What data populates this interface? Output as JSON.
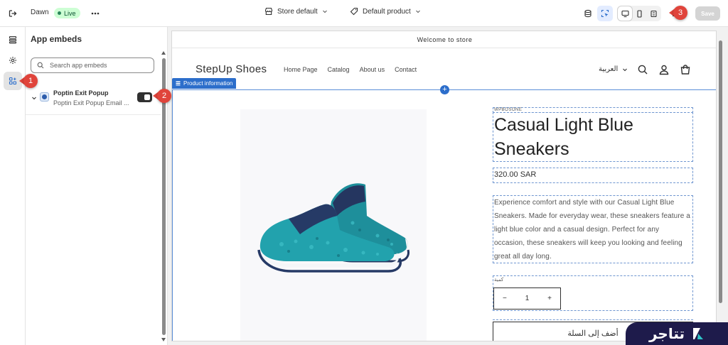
{
  "topbar": {
    "theme_name": "Dawn",
    "live_label": "Live",
    "store_select": "Store default",
    "product_select": "Default product",
    "save_label": "Save"
  },
  "panel": {
    "title": "App embeds",
    "search_placeholder": "Search app embeds",
    "embed": {
      "title": "Poptin Exit Popup",
      "subtitle": "Poptin Exit Popup Email ...",
      "enabled": true
    }
  },
  "callouts": [
    "1",
    "2",
    "3"
  ],
  "preview": {
    "announcement": "Welcome to store",
    "brand": "StepUp Shoes",
    "nav": [
      "Home Page",
      "Catalog",
      "About us",
      "Contact"
    ],
    "language": "العربية",
    "section_tag": "Product information",
    "product": {
      "vendor": "WPBOSONE",
      "title": "Casual Light Blue Sneakers",
      "price": "320.00 SAR",
      "description": "Experience comfort and style with our Casual Light Blue Sneakers. Made for everyday wear, these sneakers feature a light blue color and a casual design. Perfect for any occasion, these sneakers will keep you looking and feeling great all day long.",
      "quantity_label": "كمية",
      "quantity": "1",
      "add_to_cart": "أضف إلى السلة"
    }
  },
  "watermark": {
    "text": "تتاجر"
  },
  "colors": {
    "accent": "#2c6ecb",
    "callout": "#e0443b",
    "live_badge": "#cdfed4",
    "watermark_bg": "#1e1b4b"
  },
  "icons": [
    "exit-icon",
    "more-icon",
    "store-icon",
    "tag-icon",
    "chevron-down-icon",
    "database-icon",
    "inspector-icon",
    "desktop-icon",
    "mobile-icon",
    "fullscreen-icon",
    "undo-icon",
    "sections-icon",
    "gear-icon",
    "apps-icon",
    "search-icon",
    "account-icon",
    "cart-icon",
    "plus-icon"
  ]
}
